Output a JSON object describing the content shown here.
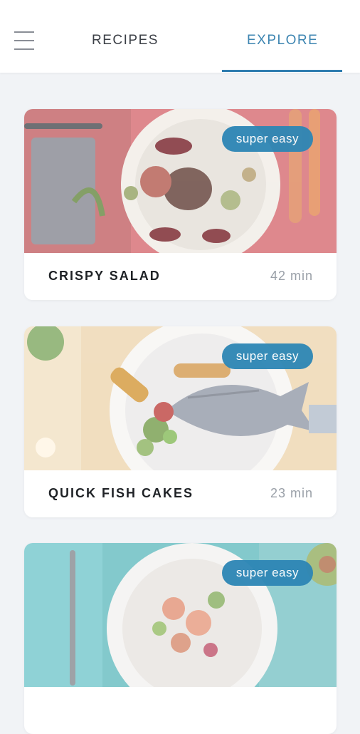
{
  "header": {
    "menu_icon": "hamburger-menu-icon",
    "tabs": [
      {
        "label": "RECIPES",
        "active": false
      },
      {
        "label": "EXPLORE",
        "active": true
      }
    ],
    "accent_color": "#2f7db0"
  },
  "recipes": [
    {
      "title": "CRISPY SALAD",
      "time": "42 min",
      "badge": "super easy"
    },
    {
      "title": "QUICK FISH CAKES",
      "time": "23 min",
      "badge": "super easy"
    },
    {
      "title": "",
      "time": "",
      "badge": "super easy"
    }
  ]
}
